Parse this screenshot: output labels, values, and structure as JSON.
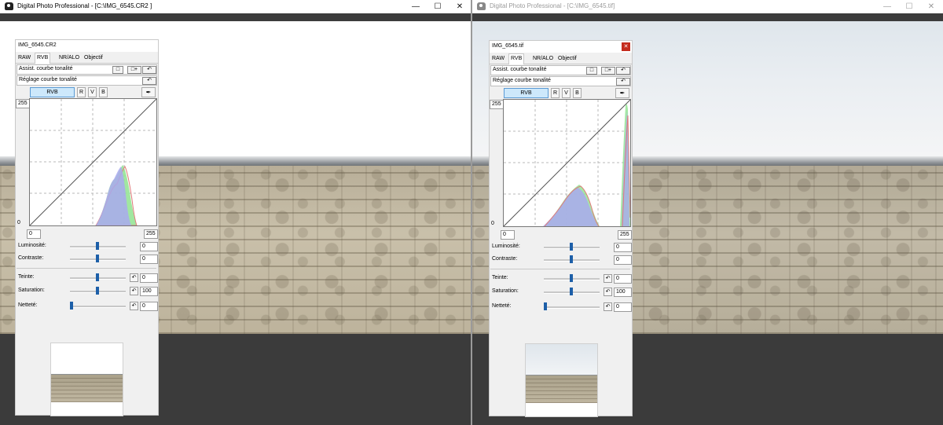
{
  "windows": [
    {
      "id": "left",
      "title": "Digital Photo Professional - [C:\\IMG_6545.CR2 ]",
      "active": true,
      "panel": {
        "title": "IMG_6545.CR2",
        "tabs": [
          "RAW",
          "RVB",
          "NR/ALO",
          "Objectif"
        ],
        "selected_tab": "RVB",
        "assist_label": "Assist. courbe tonalité",
        "curve_label": "Réglage courbe tonalité",
        "channels": [
          "RVB",
          "R",
          "V",
          "B"
        ],
        "input_max": "255",
        "input_min": "0",
        "out_left": "0",
        "out_right": "255",
        "sliders": [
          {
            "label": "Luminosité:",
            "value": "0",
            "pos": 0.5
          },
          {
            "label": "Contraste:",
            "value": "0",
            "pos": 0.5
          },
          {
            "label": "Teinte:",
            "value": "0",
            "pos": 0.5
          },
          {
            "label": "Saturation:",
            "value": "100",
            "pos": 0.5
          },
          {
            "label": "Netteté:",
            "value": "0",
            "pos": 0.0
          }
        ]
      }
    },
    {
      "id": "right",
      "title": "Digital Photo Professional - [C:\\IMG_6545.tif]",
      "active": false,
      "panel": {
        "title": "IMG_6545.tif",
        "tabs": [
          "RAW",
          "RVB",
          "NR/ALO",
          "Objectif"
        ],
        "selected_tab": "RVB",
        "assist_label": "Assist. courbe tonalité",
        "curve_label": "Réglage courbe tonalité",
        "channels": [
          "RVB",
          "R",
          "V",
          "B"
        ],
        "input_max": "255",
        "input_min": "0",
        "out_left": "0",
        "out_right": "255",
        "sliders": [
          {
            "label": "Luminosité:",
            "value": "0",
            "pos": 0.5
          },
          {
            "label": "Contraste:",
            "value": "0",
            "pos": 0.5
          },
          {
            "label": "Teinte:",
            "value": "0",
            "pos": 0.5
          },
          {
            "label": "Saturation:",
            "value": "100",
            "pos": 0.5
          },
          {
            "label": "Netteté:",
            "value": "0",
            "pos": 0.0
          }
        ]
      }
    }
  ],
  "icons": {
    "minimize": "minimize-icon",
    "maximize": "maximize-icon",
    "close": "close-icon",
    "reset": "reset-icon",
    "eyedropper": "eyedropper-icon",
    "undo": "undo-icon"
  },
  "colors": {
    "channel_selected": "#cde8fb",
    "slider_thumb": "#1d5fa8",
    "panel_close": "#c42b1c",
    "hist_blue": "#a9a9ee",
    "hist_green": "#8fe38f",
    "hist_red": "#e07a7a"
  }
}
